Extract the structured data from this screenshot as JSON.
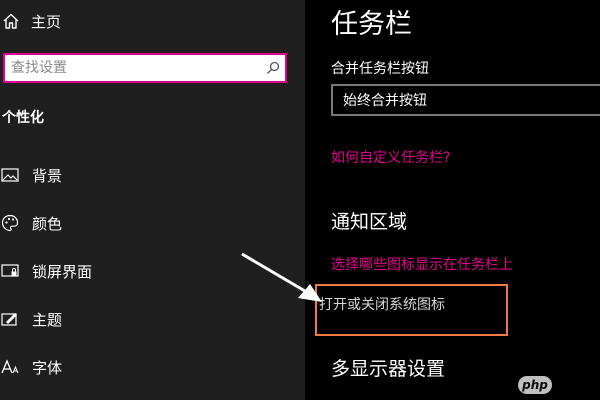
{
  "sidebar": {
    "home_label": "主页",
    "search_placeholder": "查找设置",
    "section_title": "个性化",
    "items": [
      {
        "label": "背景",
        "icon": "picture-icon"
      },
      {
        "label": "颜色",
        "icon": "palette-icon"
      },
      {
        "label": "锁屏界面",
        "icon": "lock-screen-icon"
      },
      {
        "label": "主题",
        "icon": "theme-icon"
      },
      {
        "label": "字体",
        "icon": "font-icon"
      }
    ]
  },
  "main": {
    "title": "任务栏",
    "combine_label": "合并任务栏按钮",
    "combine_value": "始终合并按钮",
    "customize_link": "如何自定义任务栏?",
    "notification_heading": "通知区域",
    "select_icons_link": "选择哪些图标显示在任务栏上",
    "toggle_system_icons_link": "打开或关闭系统图标",
    "multi_display_heading": "多显示器设置"
  },
  "watermark": "php",
  "colors": {
    "accent": "#e3008c",
    "sidebar_bg": "#1f1f1f",
    "main_bg": "#000000",
    "highlight_box": "#f07b47"
  }
}
